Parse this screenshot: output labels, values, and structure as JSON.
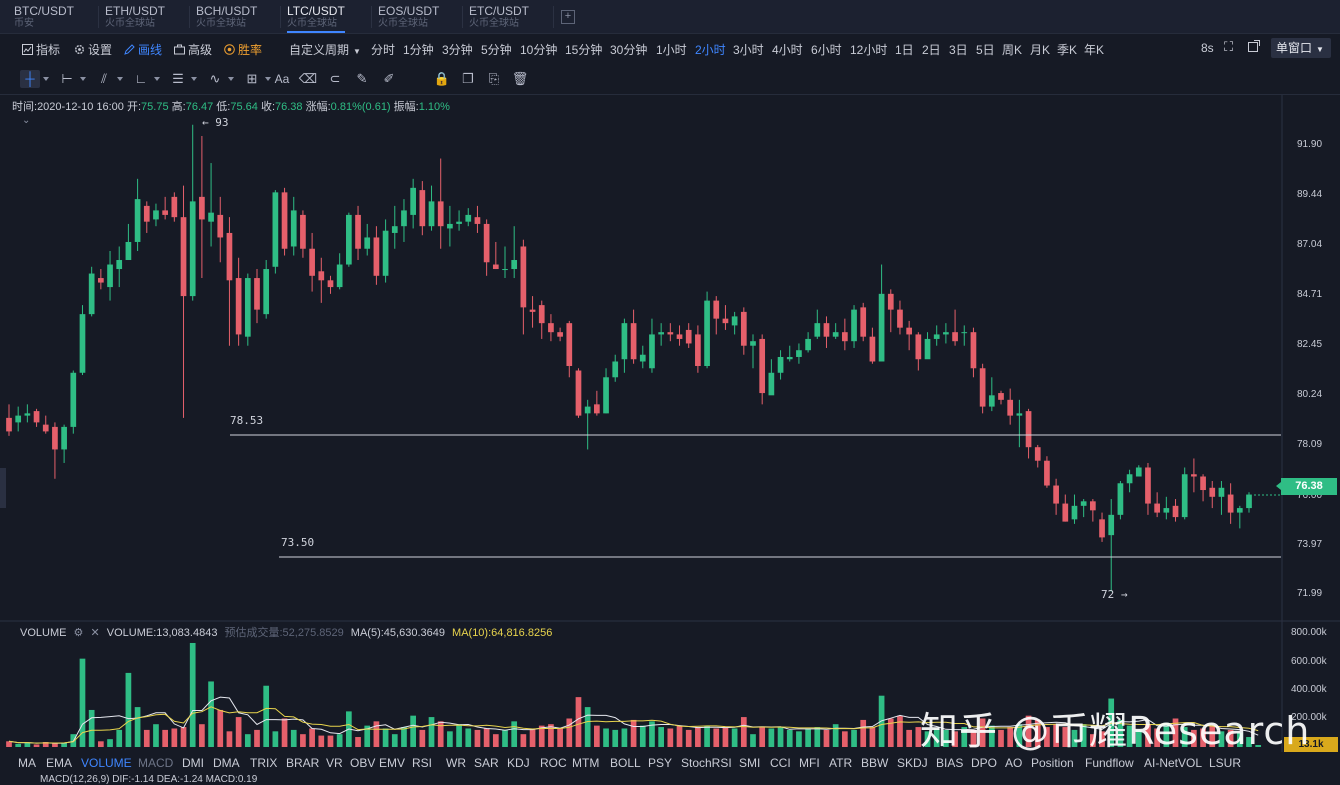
{
  "pairs": [
    {
      "symbol": "BTC/USDT",
      "exchange": "币安",
      "active": false
    },
    {
      "symbol": "ETH/USDT",
      "exchange": "火币全球站",
      "active": false
    },
    {
      "symbol": "BCH/USDT",
      "exchange": "火币全球站",
      "active": false
    },
    {
      "symbol": "LTC/USDT",
      "exchange": "火币全球站",
      "active": true
    },
    {
      "symbol": "EOS/USDT",
      "exchange": "火币全球站",
      "active": false
    },
    {
      "symbol": "ETC/USDT",
      "exchange": "火币全球站",
      "active": false
    }
  ],
  "toolbar": {
    "indicators": "指标",
    "settings": "设置",
    "draw": "画线",
    "advanced": "高级",
    "winrate": "胜率",
    "custom_period": "自定义周期",
    "countdown": "8s",
    "window_mode": "单窗口"
  },
  "periods": [
    "分时",
    "1分钟",
    "3分钟",
    "5分钟",
    "10分钟",
    "15分钟",
    "30分钟",
    "1小时",
    "2小时",
    "3小时",
    "4小时",
    "6小时",
    "12小时",
    "1日",
    "2日",
    "3日",
    "5日",
    "周K",
    "月K",
    "季K",
    "年K"
  ],
  "active_period": "2小时",
  "drawing_tools": [
    "crosshair-icon",
    "horizontal-line-icon",
    "fib-icon",
    "angle-icon",
    "parallel-lines-icon",
    "wave-icon",
    "grid-icon",
    "text-icon",
    "eraser-icon",
    "magnet-icon",
    "ruler-icon",
    "brush-icon",
    "lock-icon",
    "copy-icon",
    "screenshot-icon",
    "trash-icon"
  ],
  "info": {
    "time_label": "时间:",
    "time": "2020-12-10 16:00",
    "open_label": "开:",
    "open": "75.75",
    "high_label": "高:",
    "high": "76.47",
    "low_label": "低:",
    "low": "75.64",
    "close_label": "收:",
    "close": "76.38",
    "change_label": "涨幅:",
    "change": "0.81%(0.61)",
    "amplitude_label": "振幅:",
    "amplitude": "1.10%"
  },
  "price_axis": [
    "91.90",
    "89.44",
    "87.04",
    "84.71",
    "82.45",
    "80.24",
    "78.09",
    "76.00",
    "73.97",
    "71.99"
  ],
  "current_price": "76.38",
  "annotations": {
    "high_marker": "93",
    "low_marker": "72",
    "line_upper": "78.53",
    "line_lower": "73.50"
  },
  "volume": {
    "name": "VOLUME",
    "value_text": "VOLUME:13,083.4843",
    "estimate_text": "预估成交量:52,275.8529",
    "ma5_text": "MA(5):45,630.3649",
    "ma10_text": "MA(10):64,816.8256",
    "axis": [
      "800.00k",
      "600.00k",
      "400.00k",
      "200.00k"
    ],
    "current": "13.1k"
  },
  "indicator_tabs": [
    "MA",
    "EMA",
    "VOLUME",
    "MACD",
    "DMI",
    "DMA",
    "TRIX",
    "BRAR",
    "VR",
    "OBV",
    "EMV",
    "RSI",
    "WR",
    "SAR",
    "KDJ",
    "ROC",
    "MTM",
    "BOLL",
    "PSY",
    "StochRSI",
    "SMI",
    "CCI",
    "MFI",
    "ATR",
    "BBW",
    "SKDJ",
    "BIAS",
    "DPO",
    "AO",
    "Position",
    "Fundflow",
    "AI-NetVOL",
    "LSUR"
  ],
  "macd_row": "MACD(12,26,9)  DIF:-1.14  DEA:-1.24  MACD:0.19",
  "watermark": "知乎 @币耀Research",
  "colors": {
    "up": "#2fbd85",
    "down": "#e5606b",
    "accent": "#3f86ff",
    "bg": "#161a25"
  },
  "chart_data": {
    "type": "candlestick",
    "price_range": [
      71.2,
      93.5
    ],
    "candles": [
      [
        79.8,
        79.2,
        80.4,
        79.0
      ],
      [
        79.6,
        79.9,
        80.3,
        79.2
      ],
      [
        79.9,
        80.0,
        80.4,
        79.6
      ],
      [
        80.1,
        79.6,
        80.2,
        79.4
      ],
      [
        79.5,
        79.2,
        79.9,
        79.1
      ],
      [
        79.4,
        78.4,
        79.6,
        77.1
      ],
      [
        78.4,
        79.4,
        79.5,
        77.8
      ],
      [
        79.4,
        81.8,
        81.9,
        79.1
      ],
      [
        81.8,
        84.4,
        84.8,
        81.7
      ],
      [
        84.4,
        86.2,
        86.5,
        84.3
      ],
      [
        86.0,
        85.8,
        86.4,
        85.5
      ],
      [
        85.6,
        86.6,
        87.2,
        85.0
      ],
      [
        86.4,
        86.8,
        87.4,
        85.6
      ],
      [
        86.8,
        87.6,
        88.4,
        86.8
      ],
      [
        87.6,
        89.5,
        90.4,
        87.2
      ],
      [
        89.2,
        88.5,
        89.4,
        88.0
      ],
      [
        88.6,
        89.0,
        89.3,
        88.3
      ],
      [
        89.0,
        88.8,
        89.6,
        88.6
      ],
      [
        89.6,
        88.7,
        89.8,
        88.5
      ],
      [
        88.7,
        85.2,
        90.1,
        79.8
      ],
      [
        85.2,
        89.4,
        92.8,
        85.0
      ],
      [
        89.6,
        88.6,
        92.3,
        86.0
      ],
      [
        88.5,
        88.9,
        91.1,
        87.4
      ],
      [
        88.8,
        87.8,
        89.6,
        86.7
      ],
      [
        88.0,
        85.9,
        88.7,
        83.0
      ],
      [
        86.0,
        83.5,
        86.9,
        83.0
      ],
      [
        83.4,
        86.0,
        86.2,
        83.0
      ],
      [
        86.0,
        84.6,
        86.4,
        84.0
      ],
      [
        84.4,
        86.4,
        86.8,
        84.2
      ],
      [
        86.5,
        89.8,
        89.9,
        86.2
      ],
      [
        89.8,
        87.3,
        90.0,
        87.0
      ],
      [
        87.4,
        89.0,
        89.6,
        87.0
      ],
      [
        88.8,
        87.3,
        89.0,
        86.9
      ],
      [
        87.3,
        86.1,
        88.0,
        85.4
      ],
      [
        86.3,
        85.9,
        86.9,
        84.9
      ],
      [
        85.9,
        85.6,
        86.1,
        85.3
      ],
      [
        85.6,
        86.6,
        87.1,
        85.5
      ],
      [
        86.6,
        88.8,
        88.9,
        86.5
      ],
      [
        88.8,
        87.3,
        89.2,
        86.8
      ],
      [
        87.3,
        87.8,
        88.4,
        87.0
      ],
      [
        87.8,
        86.1,
        88.3,
        85.7
      ],
      [
        86.1,
        88.1,
        88.6,
        85.8
      ],
      [
        88.0,
        88.3,
        89.2,
        87.3
      ],
      [
        88.3,
        89.0,
        89.5,
        87.6
      ],
      [
        88.8,
        90.0,
        90.4,
        88.2
      ],
      [
        89.9,
        88.3,
        90.3,
        87.9
      ],
      [
        88.3,
        89.4,
        90.1,
        88.1
      ],
      [
        89.4,
        88.3,
        91.3,
        87.3
      ],
      [
        88.2,
        88.4,
        89.2,
        87.4
      ],
      [
        88.4,
        88.5,
        89.0,
        88.1
      ],
      [
        88.5,
        88.8,
        89.1,
        88.3
      ],
      [
        88.7,
        88.4,
        89.2,
        88.0
      ],
      [
        88.4,
        86.7,
        88.6,
        86.1
      ],
      [
        86.6,
        86.4,
        87.6,
        86.4
      ],
      [
        86.4,
        86.4,
        87.4,
        86.0
      ],
      [
        86.4,
        86.8,
        88.3,
        86.0
      ],
      [
        87.4,
        84.7,
        87.7,
        83.5
      ],
      [
        84.6,
        84.5,
        85.2,
        83.8
      ],
      [
        84.8,
        84.0,
        85.0,
        83.3
      ],
      [
        84.0,
        83.6,
        84.4,
        83.2
      ],
      [
        83.6,
        83.4,
        83.8,
        83.2
      ],
      [
        84.0,
        82.1,
        84.1,
        81.6
      ],
      [
        81.9,
        79.9,
        82.0,
        79.8
      ],
      [
        80.0,
        80.3,
        80.6,
        78.4
      ],
      [
        80.4,
        80.0,
        81.0,
        79.9
      ],
      [
        80.0,
        81.6,
        82.0,
        80.0
      ],
      [
        81.6,
        82.3,
        82.6,
        81.4
      ],
      [
        82.4,
        84.0,
        84.2,
        81.8
      ],
      [
        84.0,
        82.4,
        84.6,
        82.2
      ],
      [
        82.3,
        82.6,
        83.0,
        82.0
      ],
      [
        82.0,
        83.5,
        84.2,
        81.8
      ],
      [
        83.5,
        83.6,
        84.0,
        83.0
      ],
      [
        83.6,
        83.5,
        84.0,
        83.2
      ],
      [
        83.5,
        83.3,
        83.9,
        83.0
      ],
      [
        83.7,
        83.1,
        84.0,
        82.9
      ],
      [
        83.5,
        82.1,
        83.9,
        81.8
      ],
      [
        82.1,
        85.0,
        85.4,
        82.0
      ],
      [
        85.0,
        84.2,
        85.2,
        83.5
      ],
      [
        84.2,
        84.0,
        84.8,
        83.7
      ],
      [
        83.9,
        84.3,
        84.5,
        83.5
      ],
      [
        84.5,
        83.0,
        84.7,
        82.6
      ],
      [
        83.0,
        83.2,
        83.5,
        82.0
      ],
      [
        83.3,
        80.9,
        83.5,
        80.4
      ],
      [
        80.8,
        81.8,
        82.4,
        80.9
      ],
      [
        81.8,
        82.5,
        82.8,
        81.5
      ],
      [
        82.4,
        82.5,
        83.0,
        82.3
      ],
      [
        82.5,
        82.8,
        83.1,
        82.2
      ],
      [
        82.8,
        83.3,
        83.6,
        82.7
      ],
      [
        83.4,
        84.0,
        84.6,
        83.3
      ],
      [
        84.0,
        83.4,
        84.3,
        82.9
      ],
      [
        83.4,
        83.6,
        84.0,
        83.3
      ],
      [
        83.6,
        83.2,
        84.2,
        82.8
      ],
      [
        83.2,
        84.6,
        84.8,
        82.9
      ],
      [
        84.7,
        83.4,
        84.9,
        83.2
      ],
      [
        83.4,
        82.3,
        83.8,
        82.2
      ],
      [
        82.3,
        85.3,
        86.6,
        82.4
      ],
      [
        85.3,
        84.6,
        85.5,
        83.6
      ],
      [
        84.6,
        83.8,
        85.0,
        83.5
      ],
      [
        83.8,
        83.5,
        84.1,
        82.8
      ],
      [
        83.5,
        82.4,
        83.6,
        81.9
      ],
      [
        82.4,
        83.3,
        83.6,
        82.7
      ],
      [
        83.3,
        83.5,
        83.9,
        83.0
      ],
      [
        83.5,
        83.6,
        84.0,
        83.1
      ],
      [
        83.6,
        83.2,
        84.6,
        83.0
      ],
      [
        83.6,
        83.6,
        83.9,
        83.0
      ],
      [
        83.6,
        82.0,
        83.8,
        81.6
      ],
      [
        82.0,
        80.3,
        82.2,
        80.0
      ],
      [
        80.3,
        80.8,
        81.6,
        80.1
      ],
      [
        80.9,
        80.6,
        81.0,
        80.4
      ],
      [
        80.6,
        79.9,
        81.1,
        79.5
      ],
      [
        79.9,
        80.0,
        80.6,
        78.5
      ],
      [
        80.1,
        78.5,
        80.2,
        78.0
      ],
      [
        78.5,
        77.9,
        78.6,
        77.6
      ],
      [
        77.9,
        76.8,
        78.1,
        76.7
      ],
      [
        76.8,
        76.0,
        77.1,
        75.5
      ],
      [
        76.0,
        75.2,
        76.4,
        75.2
      ],
      [
        75.3,
        75.9,
        76.4,
        75.1
      ],
      [
        75.9,
        76.1,
        76.2,
        75.4
      ],
      [
        76.1,
        75.7,
        76.2,
        75.2
      ],
      [
        75.3,
        74.5,
        75.6,
        74.3
      ],
      [
        74.6,
        75.5,
        76.2,
        72.1
      ],
      [
        75.5,
        76.9,
        77.0,
        75.3
      ],
      [
        76.9,
        77.3,
        77.5,
        76.5
      ],
      [
        77.2,
        77.6,
        77.7,
        77.2
      ],
      [
        77.6,
        76.0,
        77.8,
        75.5
      ],
      [
        76.0,
        75.6,
        76.5,
        75.4
      ],
      [
        75.6,
        75.8,
        76.3,
        75.3
      ],
      [
        75.9,
        75.4,
        76.2,
        75.2
      ],
      [
        75.4,
        77.3,
        77.6,
        75.3
      ],
      [
        77.3,
        77.2,
        78.0,
        76.5
      ],
      [
        77.2,
        76.6,
        77.3,
        76.1
      ],
      [
        76.7,
        76.3,
        77.0,
        75.8
      ],
      [
        76.3,
        76.7,
        77.0,
        75.5
      ],
      [
        76.4,
        75.6,
        76.9,
        75.1
      ],
      [
        75.6,
        75.8,
        75.9,
        74.9
      ],
      [
        75.8,
        76.4,
        76.5,
        75.6
      ]
    ],
    "volume": [
      40,
      22,
      30,
      18,
      35,
      25,
      30,
      90,
      620,
      260,
      40,
      55,
      120,
      520,
      280,
      120,
      160,
      120,
      130,
      140,
      730,
      160,
      460,
      260,
      110,
      210,
      90,
      120,
      430,
      110,
      200,
      120,
      90,
      130,
      80,
      80,
      90,
      250,
      70,
      150,
      180,
      130,
      90,
      140,
      220,
      120,
      210,
      180,
      110,
      160,
      130,
      120,
      130,
      90,
      120,
      180,
      90,
      130,
      150,
      160,
      130,
      200,
      350,
      280,
      150,
      130,
      120,
      130,
      190,
      150,
      180,
      140,
      130,
      150,
      120,
      140,
      150,
      130,
      140,
      130,
      210,
      90,
      140,
      130,
      140,
      120,
      110,
      130,
      140,
      120,
      160,
      110,
      120,
      190,
      140,
      360,
      200,
      220,
      120,
      140,
      110,
      130,
      120,
      110,
      140,
      120,
      200,
      150,
      120,
      140,
      160,
      220,
      190,
      140,
      160,
      140,
      120,
      160,
      90,
      110,
      340,
      190,
      150,
      120,
      160,
      130,
      170,
      200,
      140,
      120,
      130,
      150,
      110,
      120,
      100,
      70,
      14
    ]
  }
}
